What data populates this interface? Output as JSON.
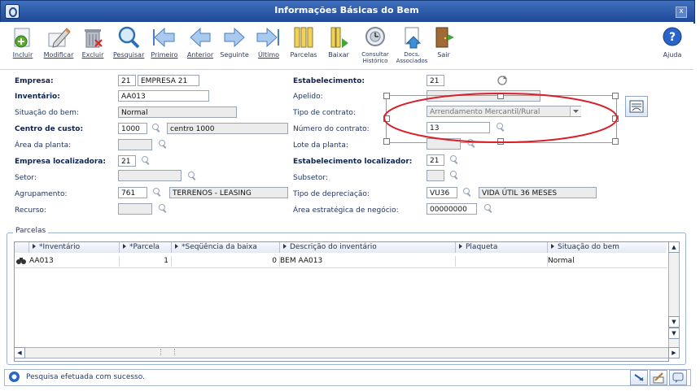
{
  "window": {
    "title": "Informações Básicas do Bem",
    "close_label": "x"
  },
  "toolbar": {
    "buttons": [
      {
        "label": "Incluir",
        "icon": "add-icon"
      },
      {
        "label": "Modificar",
        "icon": "edit-pencil-icon"
      },
      {
        "label": "Excluir",
        "icon": "trash-icon"
      },
      {
        "label": "Pesquisar",
        "icon": "magnifier-icon"
      },
      {
        "label": "Primeiro",
        "icon": "first-arrow-icon"
      },
      {
        "label": "Anterior",
        "icon": "previous-arrow-icon"
      },
      {
        "label": "Seguinte",
        "icon": "next-arrow-icon"
      },
      {
        "label": "Último",
        "icon": "last-arrow-icon"
      },
      {
        "label": "Parcelas",
        "icon": "columns-icon"
      },
      {
        "label": "Baixar",
        "icon": "write-off-icon"
      },
      {
        "label": "Consultar\nHistórico",
        "icon": "history-icon"
      },
      {
        "label": "Docs.\nAssociados",
        "icon": "documents-icon"
      },
      {
        "label": "Sair",
        "icon": "exit-door-icon"
      }
    ],
    "help_label": "Ajuda"
  },
  "form": {
    "empresa": {
      "label": "Empresa:",
      "code": "21",
      "name": "EMPRESA 21"
    },
    "inventario": {
      "label": "Inventário:",
      "value": "AA013"
    },
    "situacao": {
      "label": "Situação do bem:",
      "value": "Normal"
    },
    "centro_custo": {
      "label": "Centro de custo:",
      "code": "1000",
      "name": "centro 1000"
    },
    "area_planta": {
      "label": "Área da planta:",
      "value": ""
    },
    "empresa_localizadora": {
      "label": "Empresa localizadora:",
      "code": "21"
    },
    "setor": {
      "label": "Setor:",
      "value": ""
    },
    "agrupamento": {
      "label": "Agrupamento:",
      "code": "761",
      "name": "TERRENOS - LEASING"
    },
    "recurso": {
      "label": "Recurso:",
      "value": ""
    },
    "estabelecimento": {
      "label": "Estabelecimento:",
      "value": "21"
    },
    "apelido": {
      "label": "Apelido:",
      "value": ""
    },
    "tipo_contrato": {
      "label": "Tipo de contrato:",
      "value": "Arrendamento Mercantil/Rural"
    },
    "numero_contrato": {
      "label": "Número do contrato:",
      "value": "13"
    },
    "lote_planta": {
      "label": "Lote da planta:",
      "value": ""
    },
    "estab_localizador": {
      "label": "Estabelecimento localizador:",
      "value": "21"
    },
    "subsetor": {
      "label": "Subsetor:",
      "value": ""
    },
    "tipo_depreciacao": {
      "label": "Tipo de depreciação:",
      "code": "VU36",
      "name": "VIDA ÚTIL 36 MESES"
    },
    "area_estrategica": {
      "label": "Área estratégica de negócio:",
      "value": "00000000"
    }
  },
  "parcelas": {
    "title": "Parcelas",
    "columns": [
      "*Inventário",
      "*Parcela",
      "*Seqüência da baixa",
      "Descrição do inventário",
      "Plaqueta",
      "Situação do bem"
    ],
    "rows": [
      {
        "inventario": "AA013",
        "parcela": "1",
        "sequencia": "0",
        "descricao": "BEM AA013",
        "plaqueta": "",
        "situacao": "Normal"
      }
    ]
  },
  "status": {
    "message": "Pesquisa efetuada com sucesso."
  },
  "colors": {
    "title_bar": "#1d4796",
    "highlight_ellipse": "#d9202a",
    "label_bold": "#0f2350"
  }
}
